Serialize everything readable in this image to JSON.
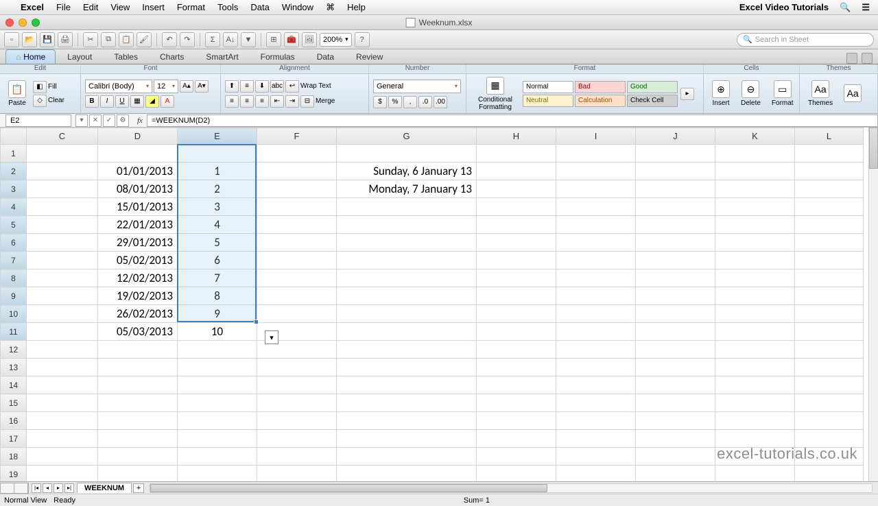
{
  "menubar": {
    "app": "Excel",
    "items": [
      "File",
      "Edit",
      "View",
      "Insert",
      "Format",
      "Tools",
      "Data",
      "Window",
      "Help"
    ],
    "right_title": "Excel Video Tutorials"
  },
  "window": {
    "filename": "Weeknum.xlsx"
  },
  "toolbar": {
    "zoom": "200%",
    "search_placeholder": "Search in Sheet"
  },
  "ribbon": {
    "tabs": [
      "Home",
      "Layout",
      "Tables",
      "Charts",
      "SmartArt",
      "Formulas",
      "Data",
      "Review"
    ],
    "active": "Home",
    "groups": [
      "Edit",
      "Font",
      "Alignment",
      "Number",
      "Format",
      "Cells",
      "Themes"
    ],
    "paste": "Paste",
    "fill": "Fill",
    "clear": "Clear",
    "font_name": "Calibri (Body)",
    "font_size": "12",
    "wrap": "Wrap Text",
    "merge": "Merge",
    "number_format": "General",
    "cond_fmt": "Conditional Formatting",
    "styles": {
      "normal": "Normal",
      "bad": "Bad",
      "good": "Good",
      "neutral": "Neutral",
      "calc": "Calculation",
      "check": "Check Cell"
    },
    "insert": "Insert",
    "delete": "Delete",
    "format": "Format",
    "themes": "Themes",
    "aa": "Aa"
  },
  "formula_bar": {
    "cell_ref": "E2",
    "formula": "=WEEKNUM(D2)"
  },
  "columns": [
    "C",
    "D",
    "E",
    "F",
    "G",
    "H",
    "I",
    "J",
    "K",
    "L"
  ],
  "rows": [
    1,
    2,
    3,
    4,
    5,
    6,
    7,
    8,
    9,
    10,
    11,
    12,
    13,
    14,
    15,
    16,
    17,
    18,
    19
  ],
  "cells": {
    "D2": "01/01/2013",
    "E2": "1",
    "G2": "Sunday, 6 January 13",
    "D3": "08/01/2013",
    "E3": "2",
    "G3": "Monday, 7 January 13",
    "D4": "15/01/2013",
    "E4": "3",
    "D5": "22/01/2013",
    "E5": "4",
    "D6": "29/01/2013",
    "E6": "5",
    "D7": "05/02/2013",
    "E7": "6",
    "D8": "12/02/2013",
    "E8": "7",
    "D9": "19/02/2013",
    "E9": "8",
    "D10": "26/02/2013",
    "E10": "9",
    "D11": "05/03/2013",
    "E11": "10"
  },
  "sheet": {
    "name": "WEEKNUM"
  },
  "status": {
    "view": "Normal View",
    "state": "Ready",
    "sum": "Sum= 1"
  },
  "watermark": "excel-tutorials.co.uk"
}
